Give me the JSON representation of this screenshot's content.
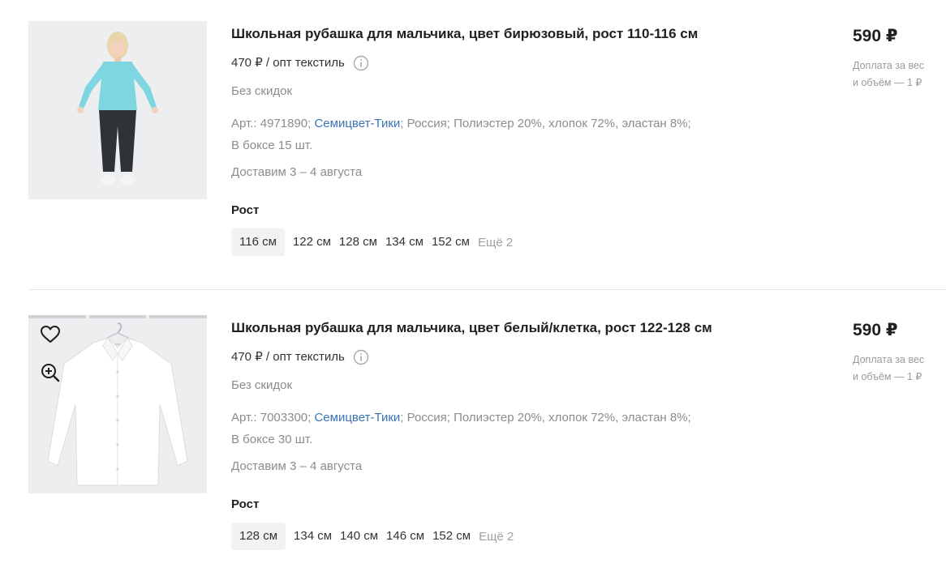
{
  "products": [
    {
      "title": "Школьная рубашка для мальчика, цвет бирюзовый, рост 110-116 см",
      "wholesale": "470 ₽ / опт текстиль",
      "discount": "Без скидок",
      "article": "Арт.: 4971890;",
      "brand": "Семицвет-Тики",
      "country": "; Россия;",
      "composition": "Полиэстер 20%, хлопок 72%, эластан 8%;",
      "box": "В боксе 15 шт.",
      "delivery": "Доставим 3 – 4 августа",
      "size_label": "Рост",
      "sizes": [
        "116 см",
        "122 см",
        "128 см",
        "134 см",
        "152 см"
      ],
      "more": "Ещё 2",
      "price": "590 ₽",
      "surcharge_1": "Доплата за вес",
      "surcharge_2": "и объём — 1 ₽",
      "shirt_color": "#7fd6e0"
    },
    {
      "title": "Школьная рубашка для мальчика, цвет белый/клетка, рост 122-128 см",
      "wholesale": "470 ₽ / опт текстиль",
      "discount": "Без скидок",
      "article": "Арт.: 7003300;",
      "brand": "Семицвет-Тики",
      "country": "; Россия;",
      "composition": "Полиэстер 20%, хлопок 72%, эластан 8%;",
      "box": "В боксе 30 шт.",
      "delivery": "Доставим 3 – 4 августа",
      "size_label": "Рост",
      "sizes": [
        "128 см",
        "134 см",
        "140 см",
        "146 см",
        "152 см"
      ],
      "more": "Ещё 2",
      "price": "590 ₽",
      "surcharge_1": "Доплата за вес",
      "surcharge_2": "и объём — 1 ₽",
      "shirt_color": "#ffffff"
    }
  ],
  "colors": {
    "brand_link": "#3b72b4",
    "muted_text": "#8c8c8c",
    "selected_chip": "#f2f2f2"
  },
  "icons": [
    "heart-icon",
    "zoom-in-icon",
    "info-icon"
  ]
}
